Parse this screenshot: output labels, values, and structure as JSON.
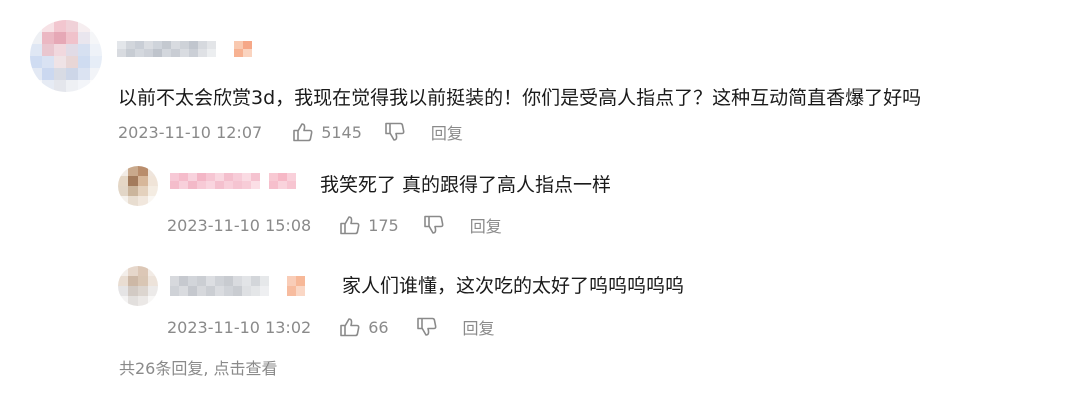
{
  "comment": {
    "text": "以前不太会欣赏3d，我现在觉得我以前挺装的！你们是受高人指点了？这种互动简直香爆了好吗",
    "time": "2023-11-10 12:07",
    "likes": "5145",
    "reply_label": "回复"
  },
  "replies": [
    {
      "text": "我笑死了 真的跟得了高人指点一样",
      "time": "2023-11-10 15:08",
      "likes": "175",
      "reply_label": "回复"
    },
    {
      "text": "家人们谁懂，这次吃的太好了呜呜呜呜呜",
      "time": "2023-11-10 13:02",
      "likes": "66",
      "reply_label": "回复"
    }
  ],
  "more_replies": "共26条回复, 点击查看",
  "icons": {
    "like": "thumbs-up-icon",
    "dislike": "thumbs-down-icon"
  },
  "colors": {
    "text": "#1a1a1a",
    "meta": "#8a8a8a"
  }
}
